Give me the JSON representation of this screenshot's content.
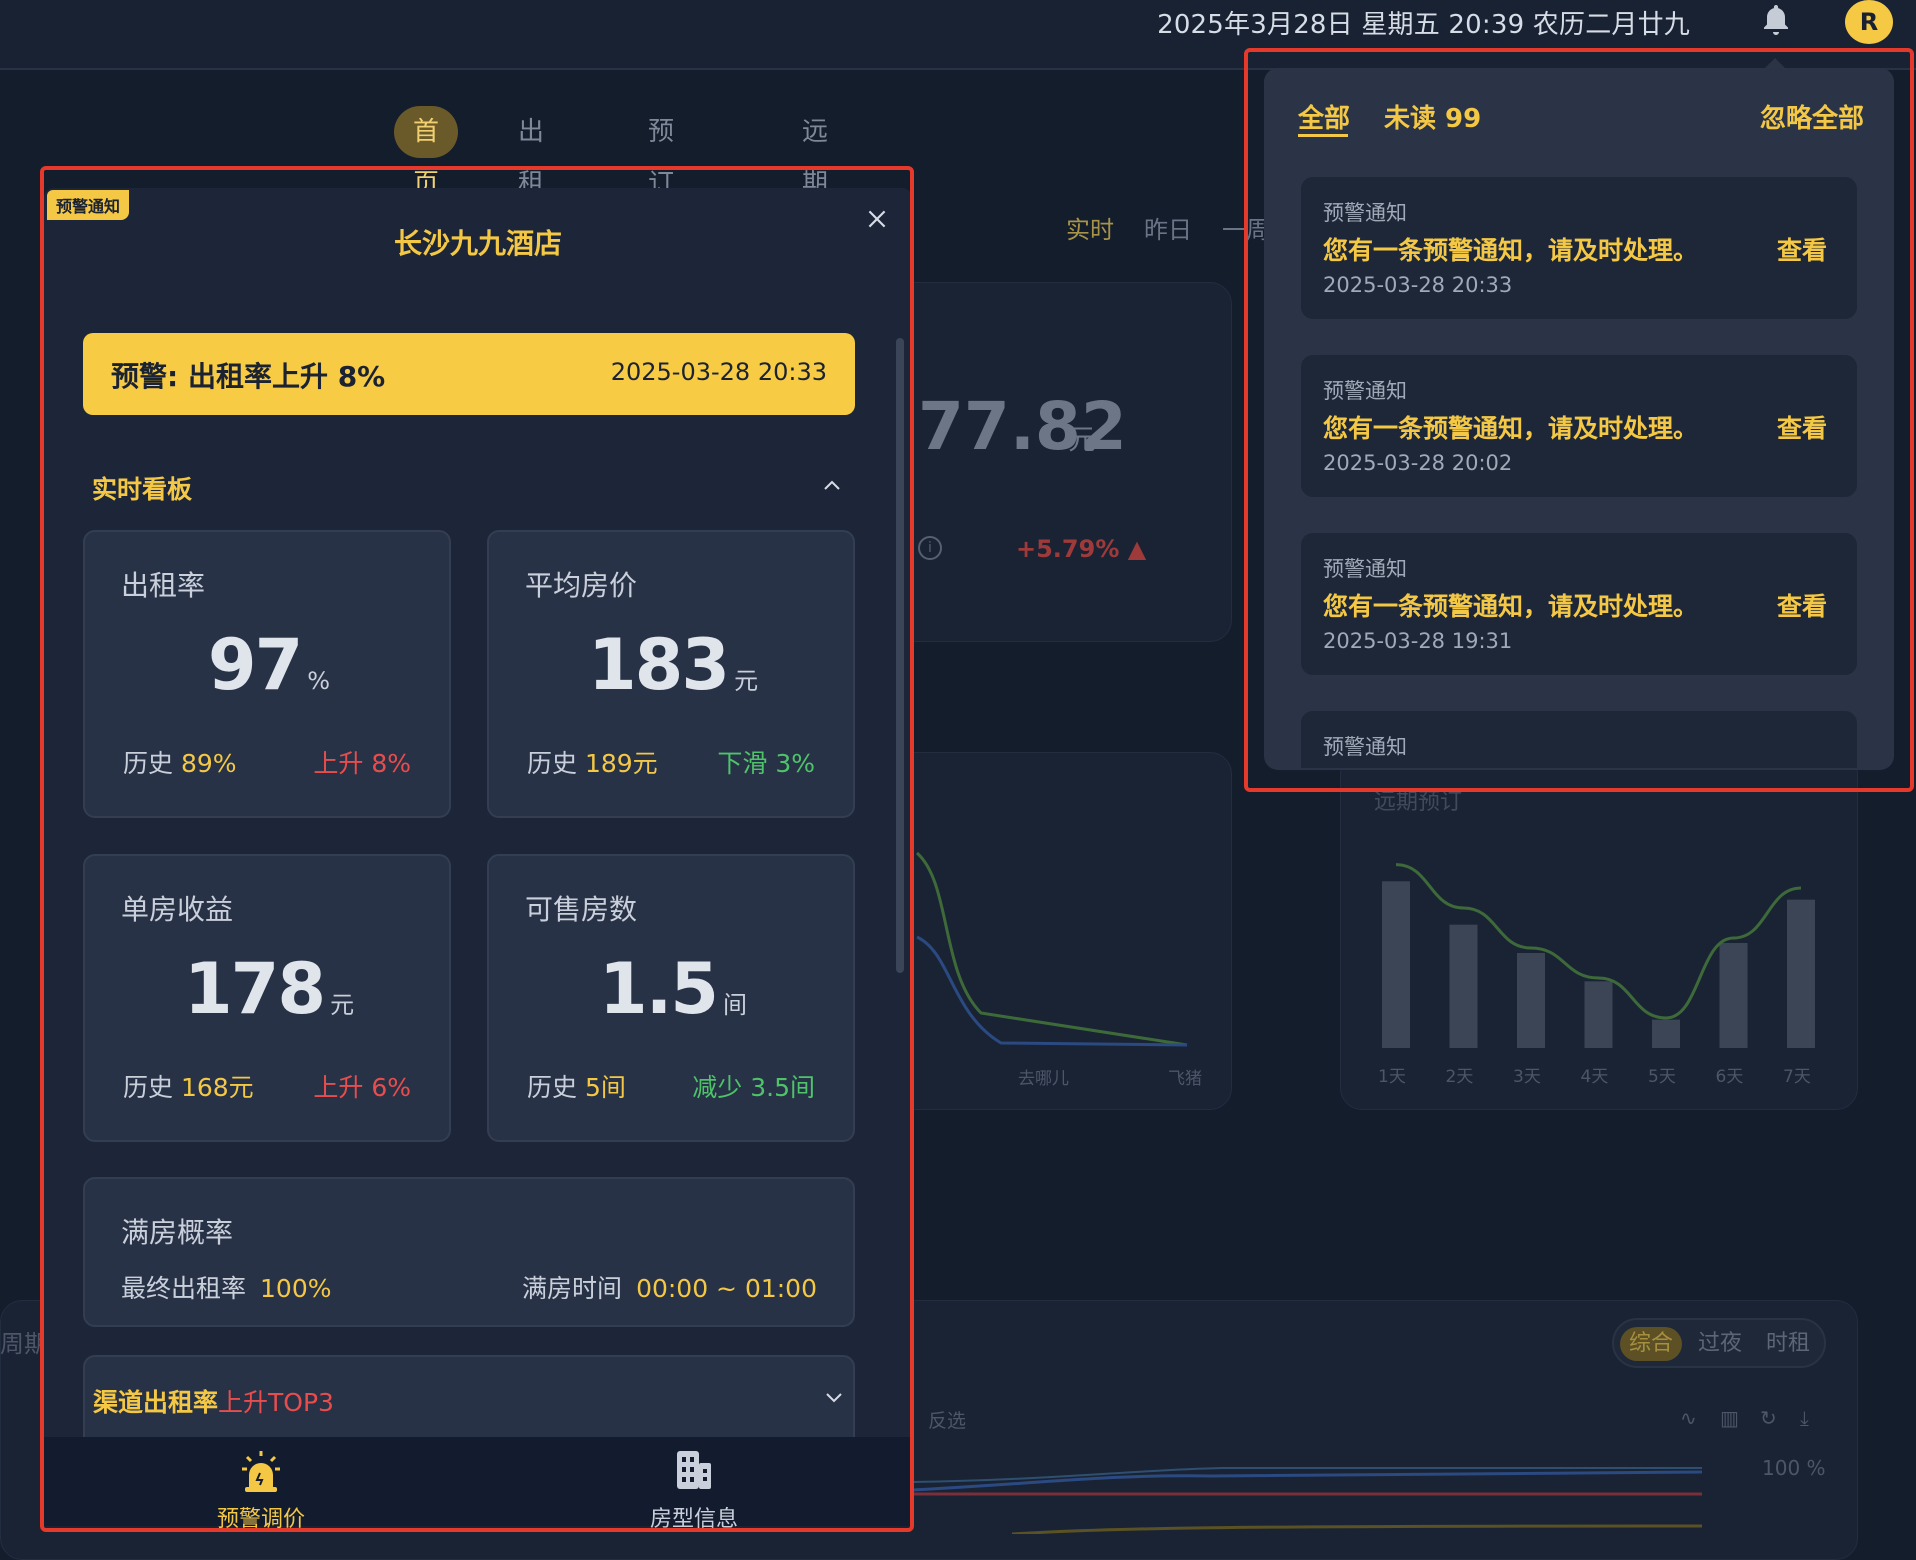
{
  "topbar": {
    "datetime": "2025年3月28日 星期五 20:39 农历二月廿九",
    "bell_icon": "bell-icon",
    "avatar_letter": "R",
    "avatar_color": "#f6c944"
  },
  "background": {
    "nav_tabs": [
      "首页",
      "出租率",
      "预订规律",
      "远期预订"
    ],
    "nav_active": "首页",
    "time_ranges": [
      "实时",
      "昨日",
      "一周"
    ],
    "big_value": "77.82",
    "big_unit": "元",
    "big_change": "+5.79%",
    "line_chart_labels": [
      "去哪儿",
      "飞猪"
    ],
    "long_booking_title": "远期预订",
    "bar_chart": {
      "type": "bar",
      "title": "远期预订",
      "categories": [
        "1天",
        "2天",
        "3天",
        "4天",
        "5天",
        "6天",
        "7天"
      ],
      "values": [
        100,
        74,
        57,
        40,
        17,
        63,
        89
      ],
      "line_values": [
        110,
        84,
        60,
        42,
        18,
        66,
        96
      ]
    },
    "period_label": "周期",
    "segment_options": [
      "综合",
      "过夜",
      "时租"
    ],
    "segment_active": "综合",
    "invert_label": "反选",
    "percent_label": "100 %"
  },
  "modal": {
    "badge": "预警通知",
    "title": "长沙九九酒店",
    "alert_text": "预警: 出租率上升 8%",
    "alert_time": "2025-03-28 20:33",
    "section_title": "实时看板",
    "kpis": [
      {
        "label": "出租率",
        "value": "97",
        "unit": "%",
        "hist_prefix": "历史",
        "hist_value": "89%",
        "change": "上升 8%",
        "dir": "up"
      },
      {
        "label": "平均房价",
        "value": "183",
        "unit": "元",
        "hist_prefix": "历史",
        "hist_value": "189元",
        "change": "下滑 3%",
        "dir": "down"
      },
      {
        "label": "单房收益",
        "value": "178",
        "unit": "元",
        "hist_prefix": "历史",
        "hist_value": "168元",
        "change": "上升 6%",
        "dir": "up"
      },
      {
        "label": "可售房数",
        "value": "1.5",
        "unit": "间",
        "hist_prefix": "历史",
        "hist_value": "5间",
        "change": "减少 3.5间",
        "dir": "down"
      }
    ],
    "full_house": {
      "label": "满房概率",
      "final_rate_label": "最终出租率",
      "final_rate_value": "100%",
      "full_time_label": "满房时间",
      "full_time_value": "00:00 ~ 01:00"
    },
    "channel": {
      "prefix": "渠道出租率",
      "suffix": "上升TOP3"
    },
    "bottom_tabs": [
      {
        "label": "预警调价",
        "icon": "alarm-icon",
        "active": true
      },
      {
        "label": "房型信息",
        "icon": "building-icon",
        "active": false
      }
    ],
    "accent_color": "#f4c845"
  },
  "notifications": {
    "tab_all": "全部",
    "tab_unread": "未读 99",
    "ignore_all": "忽略全部",
    "items": [
      {
        "type": "预警通知",
        "message": "您有一条预警通知，请及时处理。",
        "time": "2025-03-28 20:33",
        "action": "查看"
      },
      {
        "type": "预警通知",
        "message": "您有一条预警通知，请及时处理。",
        "time": "2025-03-28 20:02",
        "action": "查看"
      },
      {
        "type": "预警通知",
        "message": "您有一条预警通知，请及时处理。",
        "time": "2025-03-28 19:31",
        "action": "查看"
      },
      {
        "type": "预警通知"
      }
    ]
  }
}
